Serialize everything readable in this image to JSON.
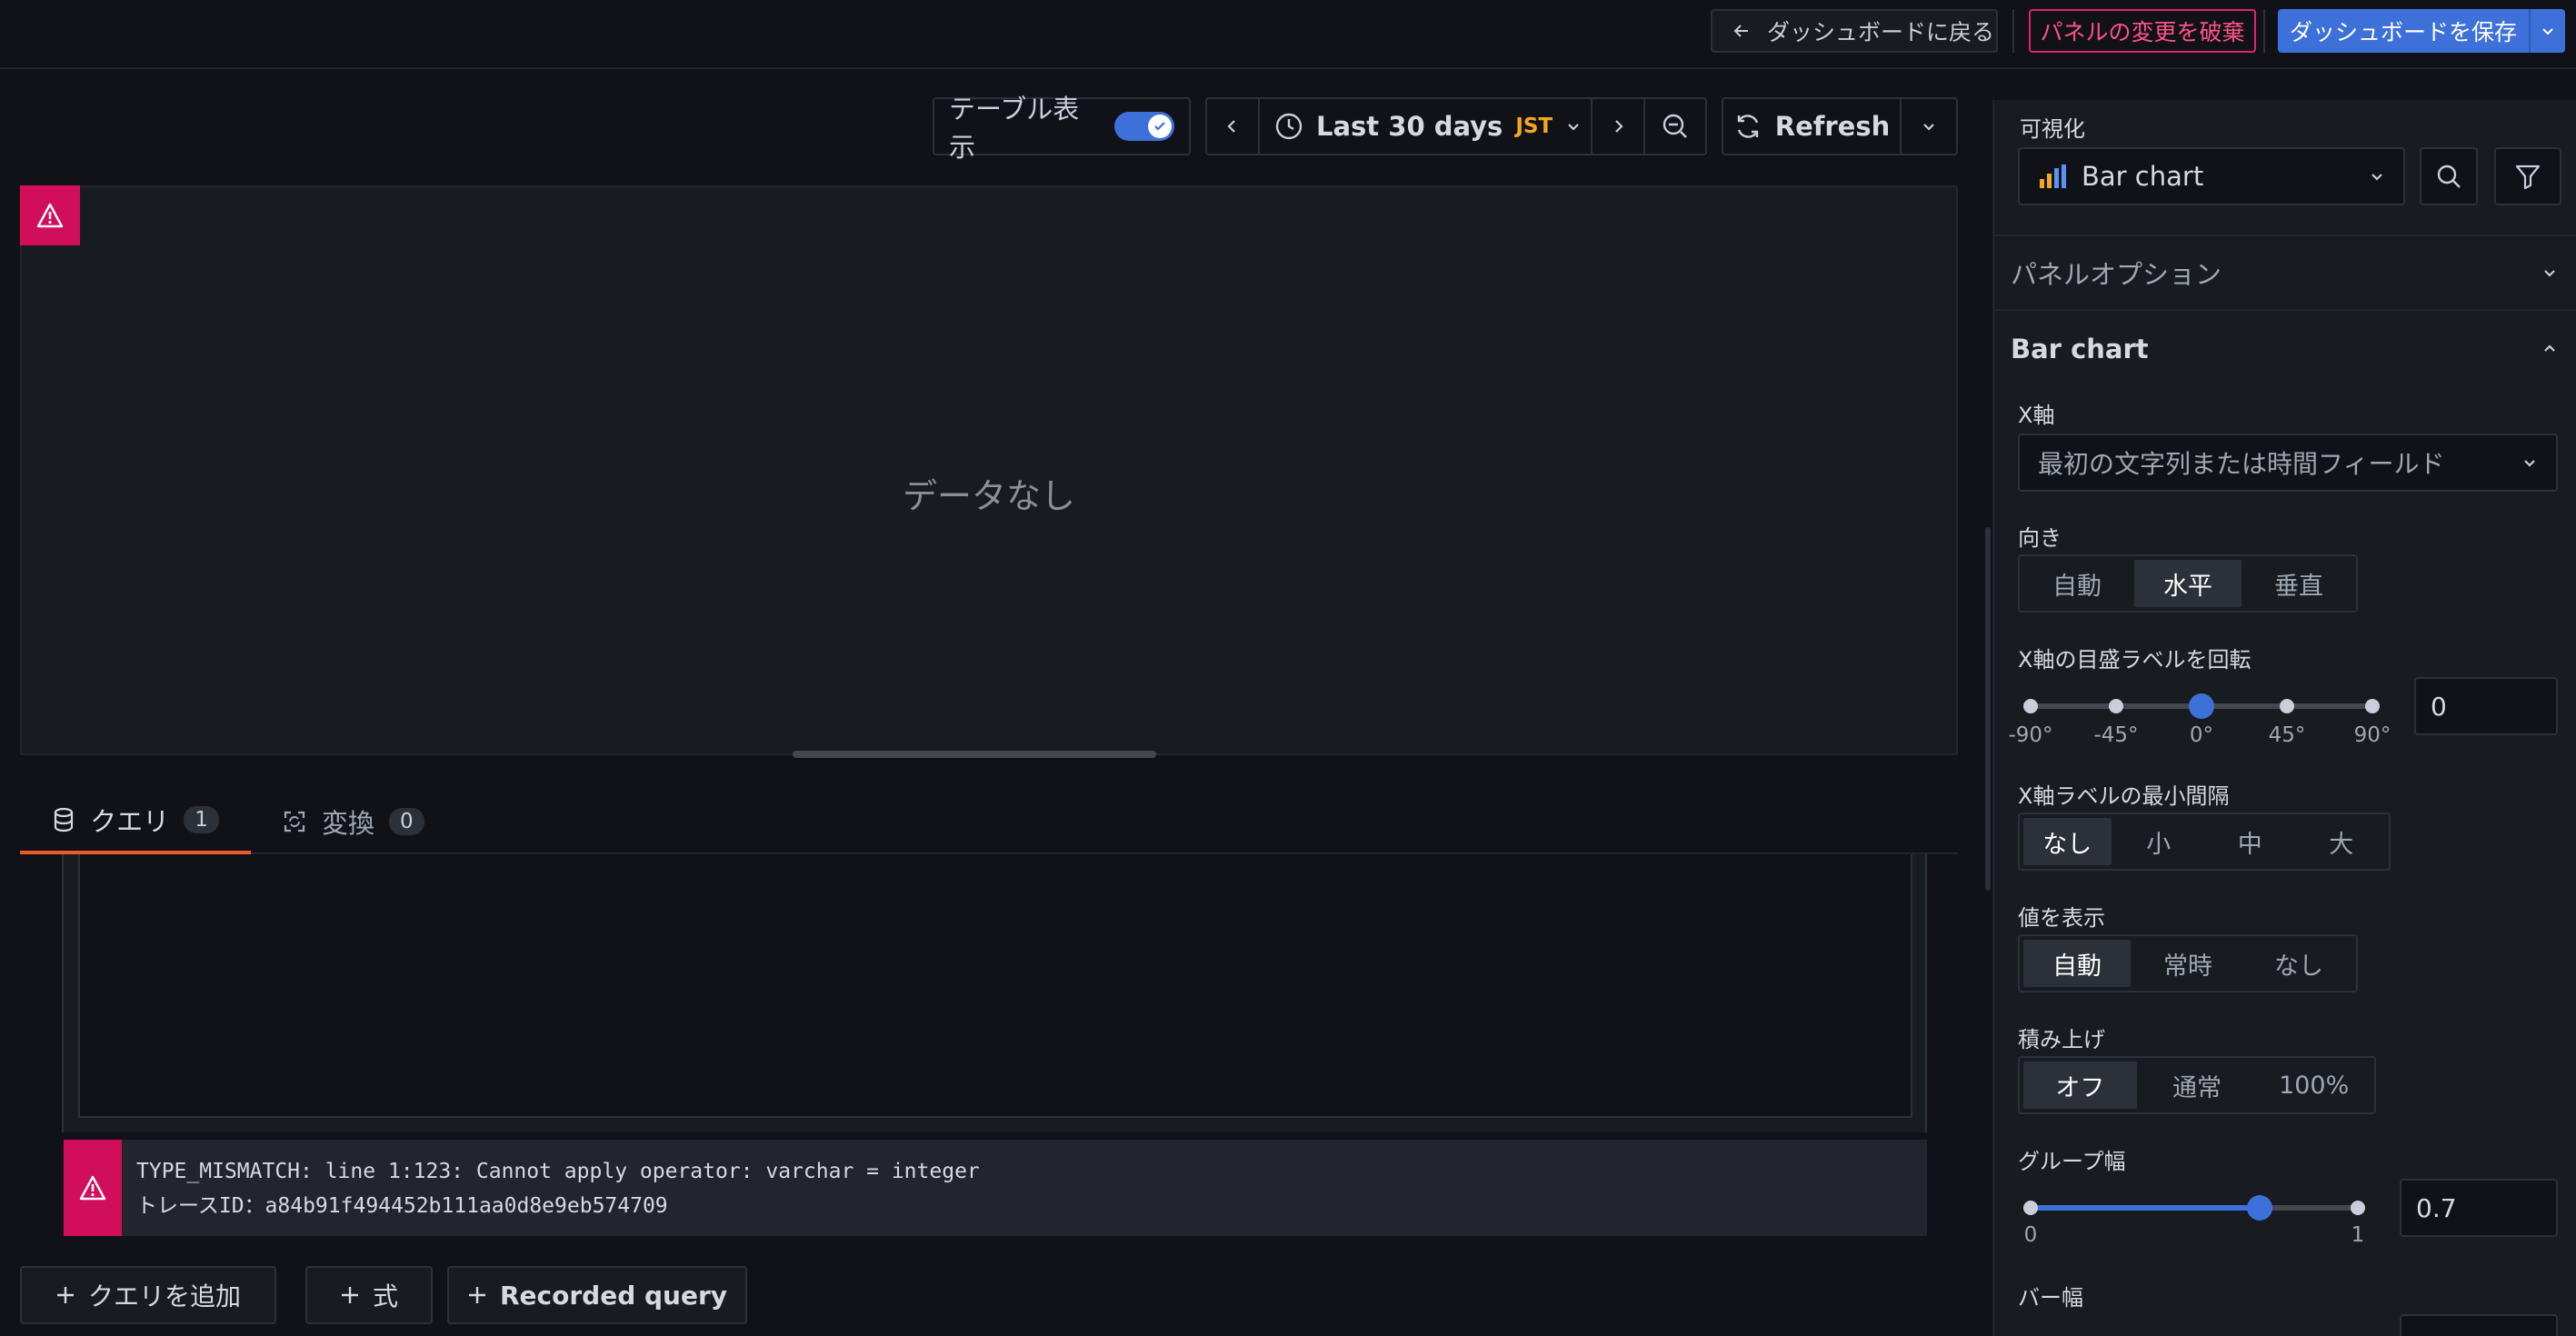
{
  "topbar": {
    "back_label": "ダッシュボードに戻る",
    "discard_label": "パネルの変更を破棄",
    "save_label": "ダッシュボードを保存"
  },
  "toolbar": {
    "table_view_label": "テーブル表示",
    "table_view_on": true,
    "time_range": "Last 30 days",
    "timezone": "JST",
    "refresh_label": "Refresh"
  },
  "panel": {
    "no_data": "データなし"
  },
  "tabs": [
    {
      "label": "クエリ",
      "count": "1"
    },
    {
      "label": "変換",
      "count": "0"
    }
  ],
  "query_error": {
    "line1": "TYPE_MISMATCH: line 1:123: Cannot apply operator: varchar = integer",
    "line2": "トレースID：a84b91f494452b111aa0d8e9eb574709"
  },
  "bottom_buttons": {
    "add_query": "クエリを追加",
    "expression": "式",
    "recorded_query": "Recorded query"
  },
  "sidebar": {
    "visualization_label": "可視化",
    "visualization_value": "Bar chart",
    "panel_options": "パネルオプション",
    "section_title": "Bar chart",
    "x_axis_label": "X軸",
    "x_axis_value": "最初の文字列または時間フィールド",
    "orientation_label": "向き",
    "orientation_options": [
      "自動",
      "水平",
      "垂直"
    ],
    "orientation_selected": "水平",
    "rotate_label": "X軸の目盛ラベルを回転",
    "rotate_ticks": [
      "-90°",
      "-45°",
      "0°",
      "45°",
      "90°"
    ],
    "rotate_value": "0",
    "spacing_label": "X軸ラベルの最小間隔",
    "spacing_options": [
      "なし",
      "小",
      "中",
      "大"
    ],
    "spacing_selected": "なし",
    "show_values_label": "値を表示",
    "show_values_options": [
      "自動",
      "常時",
      "なし"
    ],
    "show_values_selected": "自動",
    "stacking_label": "積み上げ",
    "stacking_options": [
      "オフ",
      "通常",
      "100%"
    ],
    "stacking_selected": "オフ",
    "group_width_label": "グループ幅",
    "group_width_min": "0",
    "group_width_max": "1",
    "group_width_value": "0.7",
    "bar_width_label": "バー幅"
  },
  "colors": {
    "accent": "#3d71d9",
    "danger": "#d10e5c",
    "tab_active": "#f05a28",
    "timezone": "#f5a623"
  }
}
